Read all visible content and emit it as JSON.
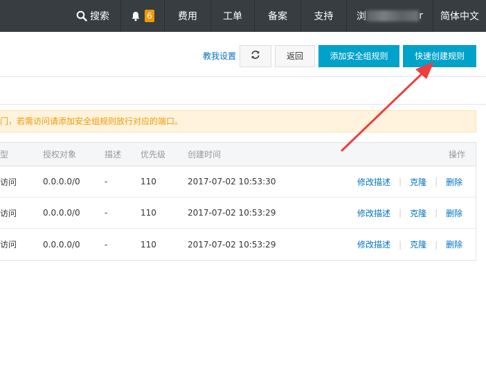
{
  "topbar": {
    "search": "搜索",
    "notify_count": "6",
    "fee": "费用",
    "ticket": "工单",
    "record": "备案",
    "support": "支持",
    "user_prefix": "浏",
    "user_suffix": "r",
    "language": "简体中文"
  },
  "toolbar": {
    "help_link": "教我设置",
    "back_label": "返回",
    "add_rule_label": "添加安全组规则",
    "quick_rule_label": "快速创建规则"
  },
  "notice": {
    "text": "门，若需访问请添加安全组规则放行对应的端口。"
  },
  "table": {
    "headers": {
      "type": "型",
      "object": "授权对象",
      "desc": "描述",
      "priority": "优先级",
      "time": "创建时间",
      "actions": "操作"
    },
    "rows": [
      {
        "type": "访问",
        "object": "0.0.0.0/0",
        "desc": "-",
        "priority": "110",
        "time": "2017-07-02 10:53:30"
      },
      {
        "type": "访问",
        "object": "0.0.0.0/0",
        "desc": "-",
        "priority": "110",
        "time": "2017-07-02 10:53:29"
      },
      {
        "type": "访问",
        "object": "0.0.0.0/0",
        "desc": "-",
        "priority": "110",
        "time": "2017-07-02 10:53:29"
      }
    ],
    "ops": {
      "edit": "修改描述",
      "clone": "克隆",
      "delete": "删除",
      "separator": "|"
    }
  },
  "colors": {
    "topbar": "#373d41",
    "primary": "#00a2ca",
    "link": "#0073c6",
    "warning": "#f39800",
    "annotation": "#f03c3c"
  },
  "icons": {
    "search": "search-icon",
    "bell": "bell-icon",
    "refresh": "refresh-icon"
  }
}
